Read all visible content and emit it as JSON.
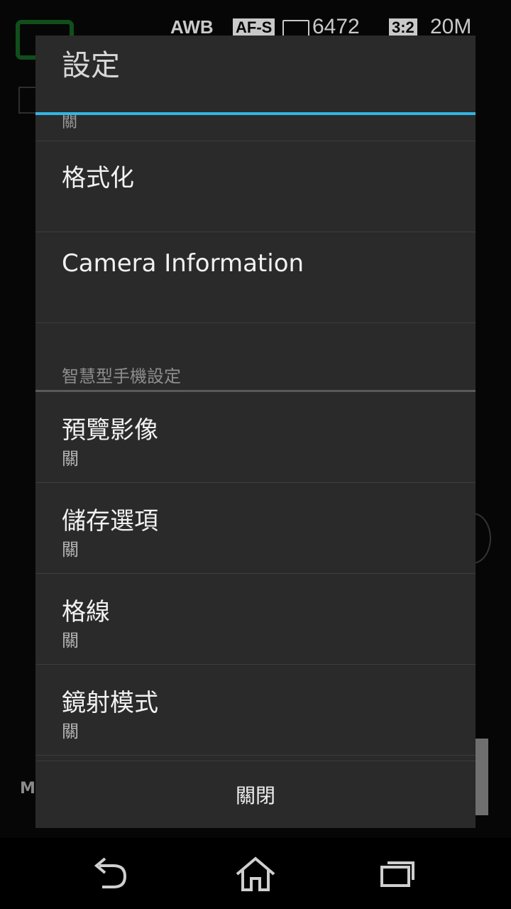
{
  "status_bar": {
    "awb": "AWB",
    "af": "AF-S",
    "shots_remaining": "6472",
    "aspect": "3:2",
    "size": "20M"
  },
  "background": {
    "mode_label": "M"
  },
  "dialog": {
    "title": "設定",
    "partial_item_value": "關",
    "items_top": [
      {
        "title": "格式化"
      },
      {
        "title": "Camera Information"
      }
    ],
    "section_header": "智慧型手機設定",
    "items": [
      {
        "title": "預覽影像",
        "value": "關"
      },
      {
        "title": "儲存選項",
        "value": "關"
      },
      {
        "title": "格線",
        "value": "關"
      },
      {
        "title": "鏡射模式",
        "value": "關"
      }
    ],
    "close_label": "關閉"
  },
  "navigation": {
    "back_icon": "back-icon",
    "home_icon": "home-icon",
    "recents_icon": "recents-icon"
  },
  "colors": {
    "accent": "#33b5e5",
    "dialog_bg": "#2a2a2a"
  }
}
